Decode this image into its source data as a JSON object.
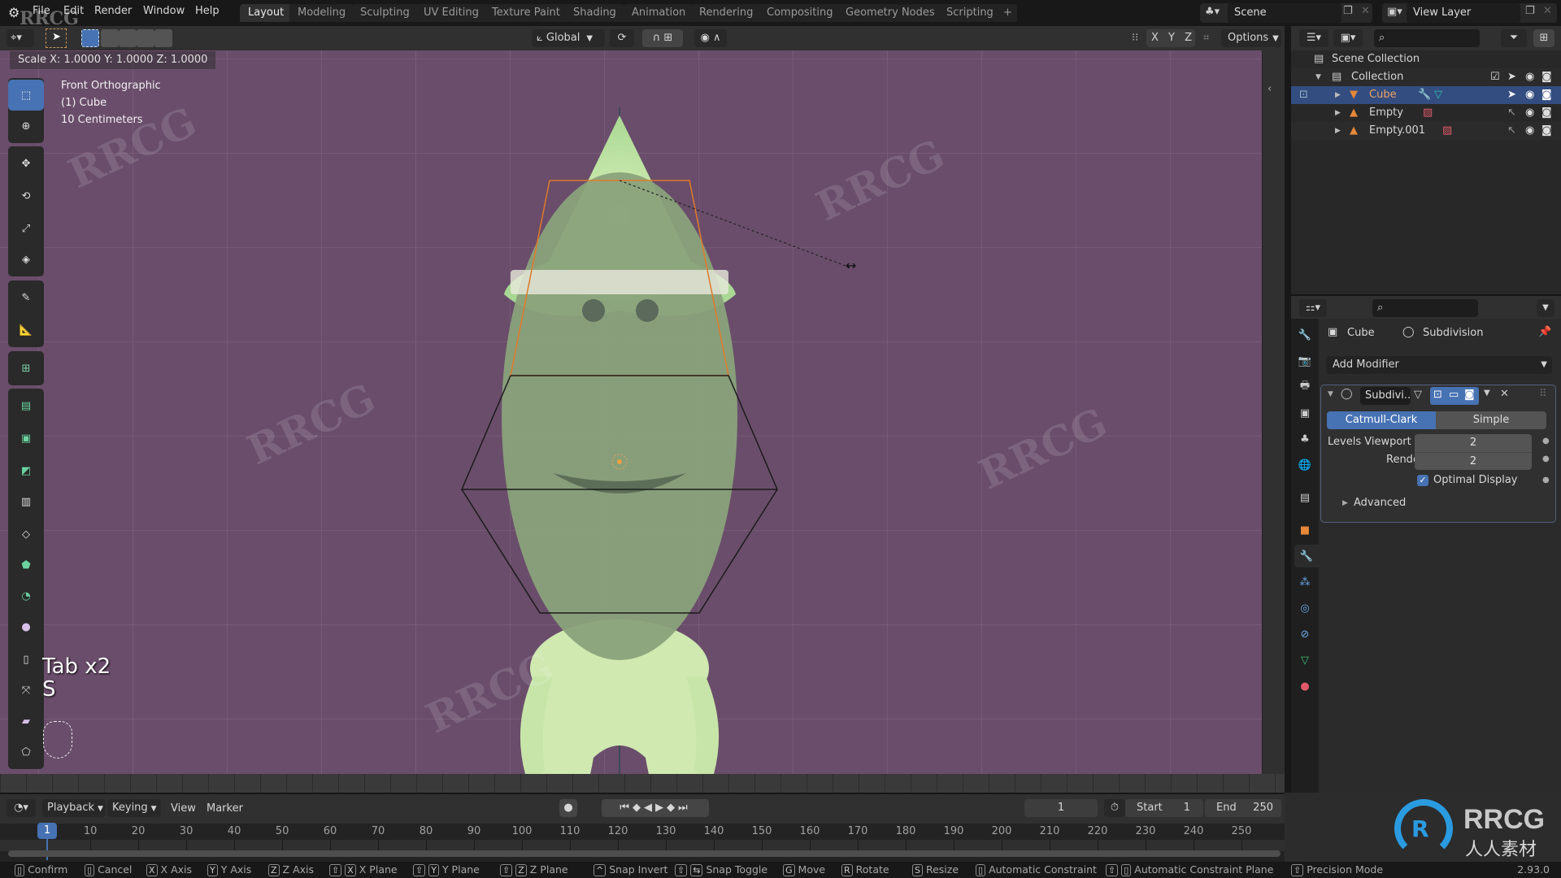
{
  "topbar": {
    "menus": [
      "File",
      "Edit",
      "Render",
      "Window",
      "Help"
    ],
    "workspaces": [
      "Layout",
      "Modeling",
      "Sculpting",
      "UV Editing",
      "Texture Paint",
      "Shading",
      "Animation",
      "Rendering",
      "Compositing",
      "Geometry Nodes",
      "Scripting"
    ],
    "active_workspace": "Layout",
    "add_workspace": "+",
    "scene": "Scene",
    "view_layer": "View Layer"
  },
  "viewport_header": {
    "transform_orientation": "Global",
    "axes": [
      "X",
      "Y",
      "Z"
    ],
    "options_label": "Options"
  },
  "viewport": {
    "scale_readout": "Scale X: 1.0000   Y: 1.0000  Z: 1.0000",
    "view_name": "Front Orthographic",
    "active_object": "(1) Cube",
    "grid_scale": "10 Centimeters",
    "key_overlay_line1": "Tab x2",
    "key_overlay_line2": "S",
    "colors": {
      "background": "#6a4d6b",
      "character": "#cfe9b0",
      "selection_outline": "#e07a2a"
    },
    "tools": [
      "select-box",
      "cursor",
      "move",
      "rotate",
      "scale",
      "transform",
      "annotate",
      "measure",
      "add-cube",
      "extrude-region",
      "inset-faces",
      "bevel",
      "loop-cut",
      "knife",
      "poly-build",
      "spin",
      "smooth",
      "edge-slide",
      "shrink-fatten",
      "shear",
      "rip-region"
    ]
  },
  "outliner": {
    "root": "Scene Collection",
    "items": [
      {
        "name": "Collection",
        "type": "collection",
        "level": 1
      },
      {
        "name": "Cube",
        "type": "mesh",
        "level": 2,
        "selected": true
      },
      {
        "name": "Empty",
        "type": "empty",
        "level": 2
      },
      {
        "name": "Empty.001",
        "type": "empty",
        "level": 2
      }
    ]
  },
  "properties": {
    "breadcrumb_object": "Cube",
    "breadcrumb_modifier": "Subdivision",
    "add_modifier_label": "Add Modifier",
    "modifier_name": "Subdivi...",
    "subdivision_types": [
      "Catmull-Clark",
      "Simple"
    ],
    "active_type": "Catmull-Clark",
    "levels_viewport_label": "Levels Viewport",
    "levels_viewport": "2",
    "render_label": "Render",
    "render_levels": "2",
    "optimal_display_label": "Optimal Display",
    "optimal_display": true,
    "advanced_label": "Advanced",
    "accent_color": "#4772b3"
  },
  "timeline": {
    "menus": [
      "Playback",
      "Keying",
      "View",
      "Marker"
    ],
    "current_frame": "1",
    "start_label": "Start",
    "start": "1",
    "end_label": "End",
    "end": "250",
    "ruler_labels": [
      "1",
      "10",
      "20",
      "30",
      "40",
      "50",
      "60",
      "70",
      "80",
      "90",
      "100",
      "110",
      "120",
      "130",
      "140",
      "150",
      "160",
      "170",
      "180",
      "190",
      "200",
      "210",
      "220",
      "230",
      "240",
      "250"
    ]
  },
  "statusbar": {
    "items": [
      {
        "keys": [
          "LMB"
        ],
        "label": "Confirm"
      },
      {
        "keys": [
          "RMB"
        ],
        "label": "Cancel"
      },
      {
        "keys": [
          "X"
        ],
        "label": "X Axis"
      },
      {
        "keys": [
          "Y"
        ],
        "label": "Y Axis"
      },
      {
        "keys": [
          "Z"
        ],
        "label": "Z Axis"
      },
      {
        "keys": [
          "⇧",
          "X"
        ],
        "label": "X Plane"
      },
      {
        "keys": [
          "⇧",
          "Y"
        ],
        "label": "Y Plane"
      },
      {
        "keys": [
          "⇧",
          "Z"
        ],
        "label": "Z Plane"
      },
      {
        "keys": [
          "^"
        ],
        "label": "Snap Invert"
      },
      {
        "keys": [
          "⇧",
          "⇆"
        ],
        "label": "Snap Toggle"
      },
      {
        "keys": [
          "G"
        ],
        "label": "Move"
      },
      {
        "keys": [
          "R"
        ],
        "label": "Rotate"
      },
      {
        "keys": [
          "S"
        ],
        "label": "Resize"
      },
      {
        "keys": [
          "MMB"
        ],
        "label": "Automatic Constraint"
      },
      {
        "keys": [
          "⇧",
          "MMB"
        ],
        "label": "Automatic Constraint Plane"
      },
      {
        "keys": [
          "⇧"
        ],
        "label": "Precision Mode"
      }
    ],
    "version": "2.93.0"
  },
  "branding": {
    "logo_text": "RRCG",
    "logo_subtext": "人人素材",
    "corner_mark": "RRCG",
    "logo_color": "#2a9be0"
  }
}
